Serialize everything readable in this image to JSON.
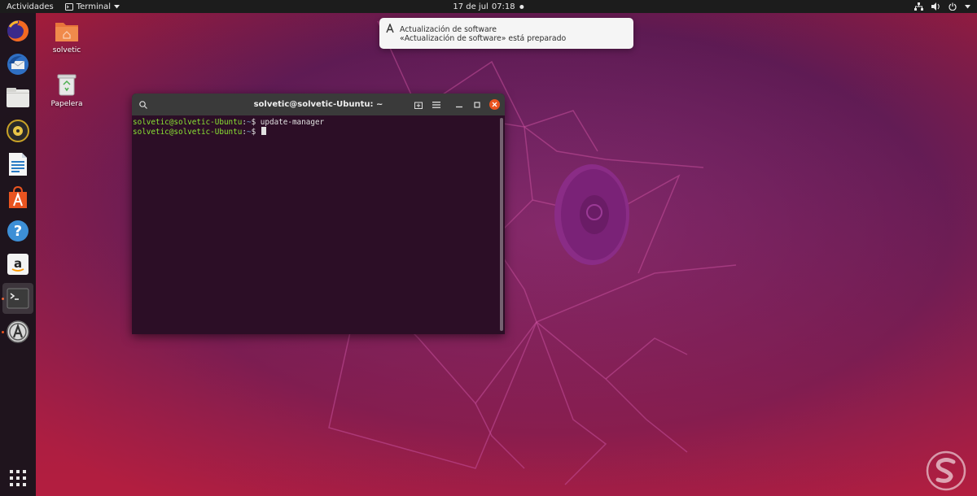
{
  "topbar": {
    "activities": "Actividades",
    "app_menu": "Terminal",
    "date": "17 de jul",
    "time": "07:18"
  },
  "dock": {
    "items": [
      {
        "icon": "firefox-icon"
      },
      {
        "icon": "thunderbird-icon"
      },
      {
        "icon": "files-icon"
      },
      {
        "icon": "rhythmbox-icon"
      },
      {
        "icon": "libreoffice-writer-icon"
      },
      {
        "icon": "software-icon"
      },
      {
        "icon": "help-icon"
      },
      {
        "icon": "amazon-icon"
      },
      {
        "icon": "terminal-icon",
        "active": true
      },
      {
        "icon": "software-updater-icon"
      },
      {
        "icon": "app-grid-icon"
      }
    ]
  },
  "desktop": {
    "home_folder": "solvetic",
    "trash": "Papelera"
  },
  "terminal": {
    "title": "solvetic@solvetic-Ubuntu: ~",
    "lines": [
      {
        "user": "solvetic@solvetic-Ubuntu",
        "path": "~",
        "symbol": "$",
        "command": "update-manager"
      },
      {
        "user": "solvetic@solvetic-Ubuntu",
        "path": "~",
        "symbol": "$",
        "command": ""
      }
    ]
  },
  "notification": {
    "title": "Actualización de software",
    "body": "«Actualización de software» está preparado"
  },
  "colors": {
    "accent": "#e95420",
    "prompt_user": "#8ae234",
    "prompt_path": "#729fcf",
    "terminal_bg": "#2c0e26"
  }
}
